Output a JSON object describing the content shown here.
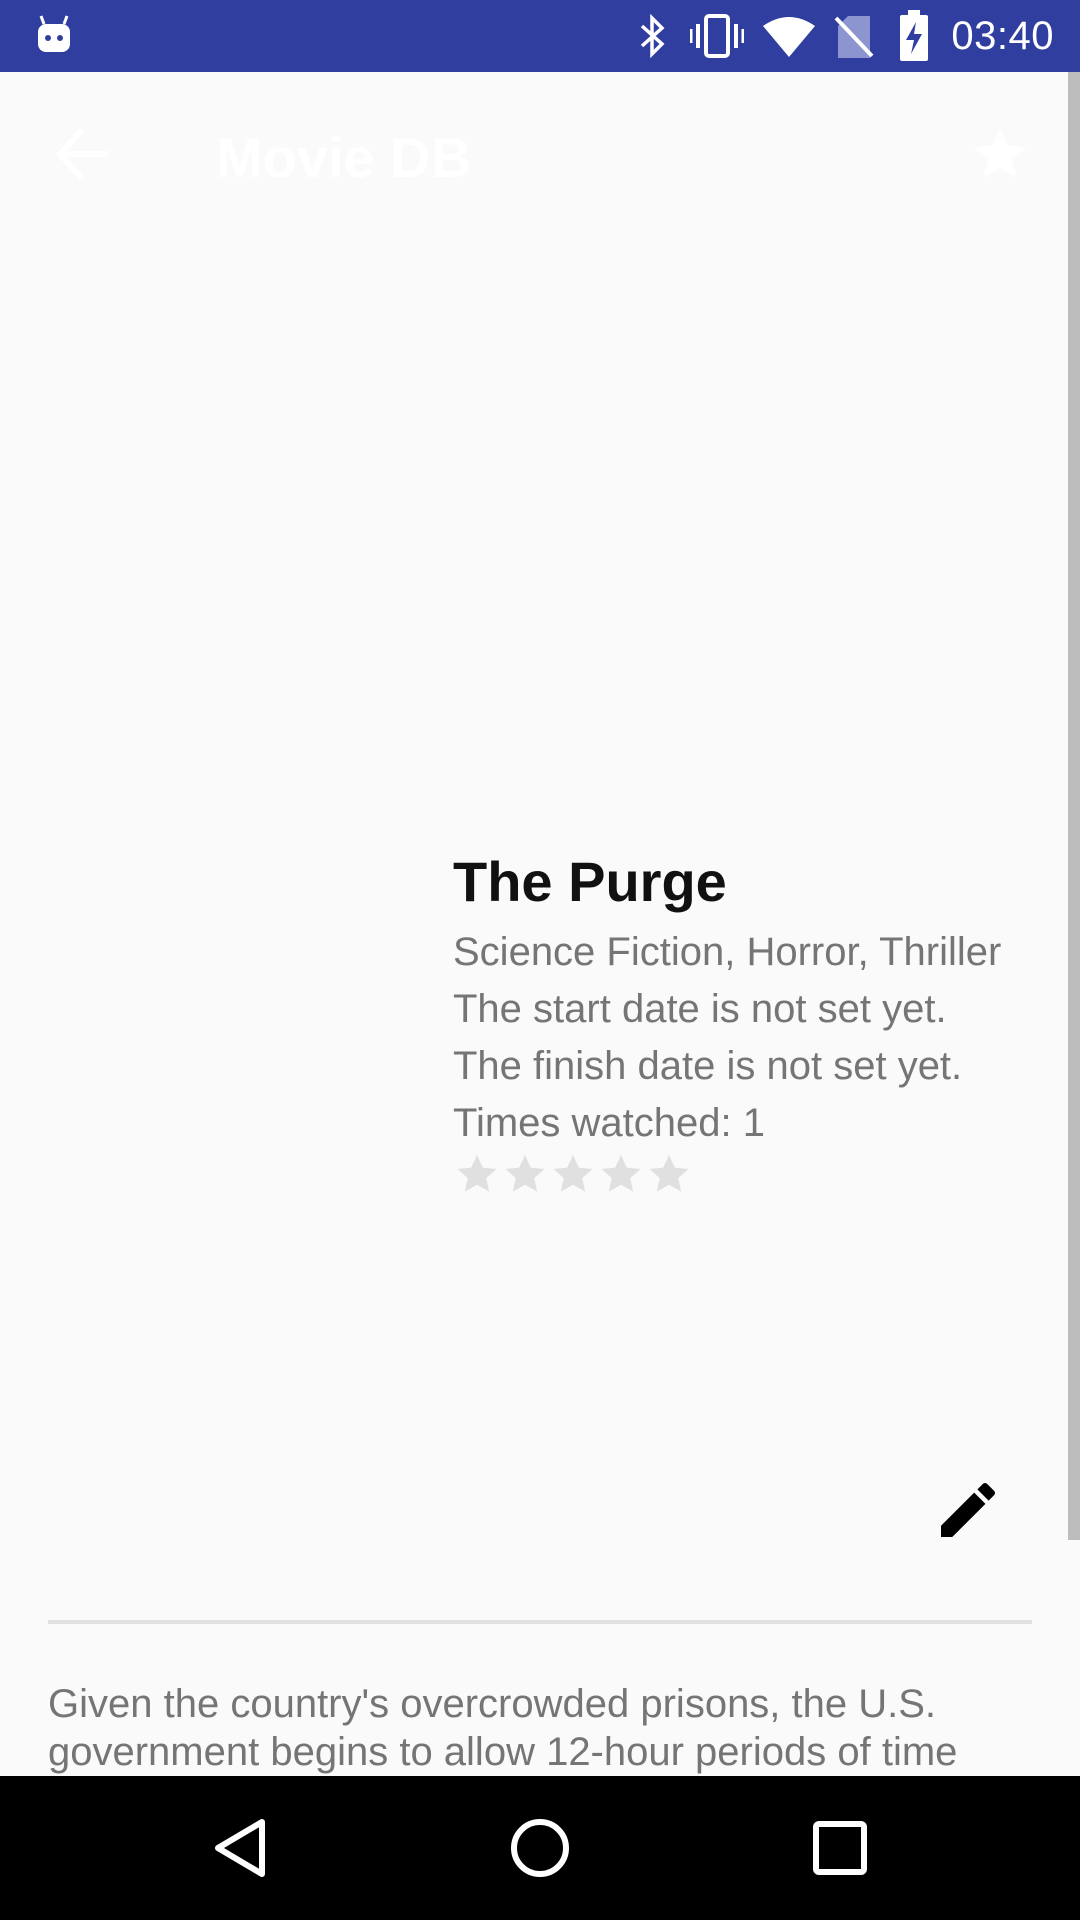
{
  "status_bar": {
    "time": "03:40",
    "icons": [
      "android-icon",
      "bluetooth-icon",
      "vibrate-icon",
      "wifi-icon",
      "no-sim-icon",
      "battery-charging-icon"
    ],
    "background_color": "#303f9f"
  },
  "app_bar": {
    "title": "Movie DB",
    "back_icon": "arrow-back-icon",
    "action_icon": "star-icon"
  },
  "movie": {
    "title": "The Purge",
    "genres": "Science Fiction, Horror, Thriller",
    "start_date": "The start date is not set yet.",
    "finish_date": "The finish date is not set yet.",
    "times_watched": "Times watched: 1",
    "rating": {
      "value": 0,
      "max": 5
    },
    "overview": "Given the country's overcrowded prisons, the U.S. government begins to allow 12-hour periods of time"
  },
  "edit_icon": "pencil-icon",
  "nav_bar": {
    "icons": [
      "back-triangle-icon",
      "home-circle-icon",
      "recents-square-icon"
    ]
  }
}
